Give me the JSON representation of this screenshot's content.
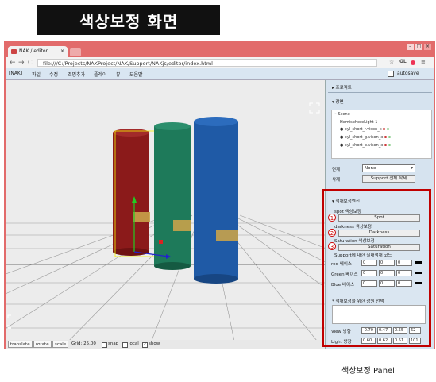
{
  "banner": {
    "title": "색상보정 화면"
  },
  "browser": {
    "tab_title": "NAK / editor",
    "tab_close": "×",
    "url": "file:///C:/Projects/NAKProject/NAK/Support/NAKjs/editor/index.html",
    "window_buttons": [
      "–",
      "□",
      "×"
    ],
    "toolbar_icons": {
      "star": "☆",
      "gl": "GL",
      "menu": "≡"
    },
    "nav": {
      "back": "←",
      "forward": "→",
      "reload": "C"
    }
  },
  "menubar": {
    "items": [
      "[NAK]",
      "파일",
      "수정",
      "조명추가",
      "플레이",
      "뷰",
      "도움말"
    ],
    "autosave_label": "autosave"
  },
  "statusbar": {
    "translate": "translate",
    "rotate": "rotate",
    "scale": "scale",
    "grid_label": "Grid: 25.00",
    "snap": "snap",
    "local": "local",
    "show": "show"
  },
  "right_panel": {
    "project_header": "프로젝트",
    "scene_header": "장면",
    "scene_tree": [
      {
        "label": "Scene",
        "dots": []
      },
      {
        "label": "HemisphereLight 1",
        "dots": []
      },
      {
        "label": "cyl_short_r.vison_x",
        "dots": [
          "#c33",
          "#8c8",
          "#8c8"
        ]
      },
      {
        "label": "cyl_short_g.vison_x",
        "dots": [
          "#c33",
          "#8c8",
          "#8c8"
        ]
      },
      {
        "label": "cyl_short_b.vison_x",
        "dots": [
          "#c33",
          "#8c8",
          "#8c8"
        ]
      }
    ],
    "link_label": "연계",
    "link_value": "None",
    "delete_label": "삭제",
    "delete_button": "Support 전체 삭제",
    "color_header": "색채보정엔진",
    "spot_label": "spot 색상보정",
    "spot_button": "Spot",
    "darkness_label": "darkness 색상보정",
    "darkness_button": "Darkness",
    "saturation_label": "Saturation 색상보정",
    "saturation_button": "Saturation",
    "support_code_label": "Support에 대한 실내색채 코드",
    "rows": [
      {
        "label": "red 베이스",
        "values": [
          "0",
          "0",
          "0"
        ]
      },
      {
        "label": "Green 베이스",
        "values": [
          "0",
          "0",
          "0"
        ]
      },
      {
        "label": "Blue 베이스",
        "values": [
          "0",
          "0",
          "0"
        ]
      }
    ],
    "light_select_label": "* 색채보정을 위한 광원 선택",
    "view_label": "View 방향",
    "view_values": [
      "-0.70",
      "0.47",
      "0.55",
      "62"
    ],
    "light_label": "Light 방향",
    "light_values": [
      "0.60",
      "0.62",
      "0.51",
      "101"
    ],
    "markers": [
      "1",
      "2",
      "3"
    ]
  },
  "caption": "색상보정 Panel",
  "colors": {
    "browser_frame": "#e26b6b",
    "highlight": "#c00000",
    "red_cylinder": "#8b1a1a",
    "green_cylinder": "#1e7a5a",
    "blue_cylinder": "#1f5aa6",
    "gold_band": "#c8a24a"
  }
}
